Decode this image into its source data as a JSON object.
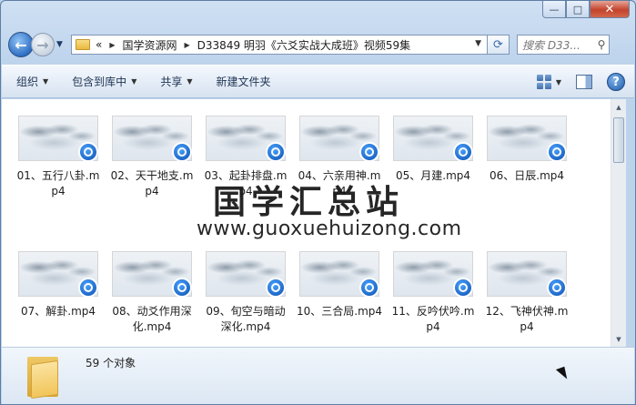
{
  "window": {
    "caption_buttons": [
      "minimize",
      "maximize",
      "close"
    ]
  },
  "nav": {
    "breadcrumb_prefix": "«",
    "breadcrumbs": [
      "国学资源网",
      "D33849 明羽《六爻实战大成班》视频59集"
    ],
    "search_placeholder": "搜索 D33..."
  },
  "toolbar": {
    "organize": "组织",
    "include_library": "包含到库中",
    "share": "共享",
    "new_folder": "新建文件夹"
  },
  "files": [
    {
      "name": "01、五行八卦.mp4"
    },
    {
      "name": "02、天干地支.mp4"
    },
    {
      "name": "03、起卦排盘.mp4"
    },
    {
      "name": "04、六亲用神.mp4"
    },
    {
      "name": "05、月建.mp4"
    },
    {
      "name": "06、日辰.mp4"
    },
    {
      "name": "07、解卦.mp4"
    },
    {
      "name": "08、动爻作用深化.mp4"
    },
    {
      "name": "09、旬空与暗动深化.mp4"
    },
    {
      "name": "10、三合局.mp4"
    },
    {
      "name": "11、反吟伏吟.mp4"
    },
    {
      "name": "12、飞神伏神.mp4"
    }
  ],
  "watermark": {
    "title": "国学汇总站",
    "url": "www.guoxuehuizong.com"
  },
  "status": {
    "item_count": "59 个对象"
  }
}
